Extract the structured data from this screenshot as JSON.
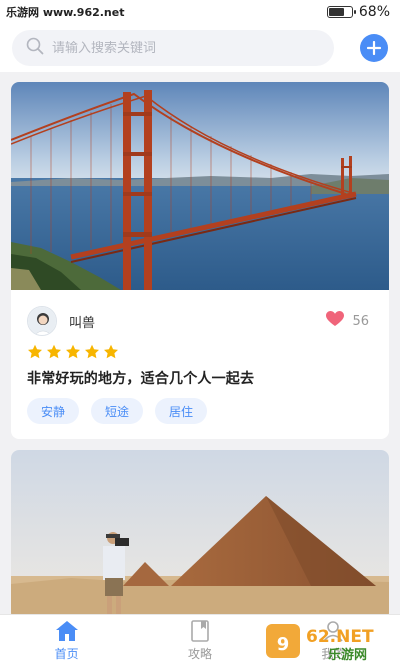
{
  "status_bar": {
    "site": "乐游网 www.962.net",
    "battery_percent": "68%",
    "battery_level": 0.68
  },
  "search": {
    "placeholder": "请输入搜索关键词"
  },
  "feed": [
    {
      "author": "叫兽",
      "likes": "56",
      "rating": 5,
      "review": "非常好玩的地方，适合几个人一起去",
      "tags": [
        "安静",
        "短途",
        "居住"
      ]
    }
  ],
  "tabbar": {
    "tabs": [
      {
        "label": "首页",
        "active": true
      },
      {
        "label": "攻略",
        "active": false
      },
      {
        "label": "我的",
        "active": false
      }
    ]
  },
  "watermark": {
    "logo_text": "962.NET",
    "sub_text": "乐游网"
  },
  "colors": {
    "accent": "#4a8df6",
    "like": "#f0647a",
    "star": "#f7b500"
  }
}
